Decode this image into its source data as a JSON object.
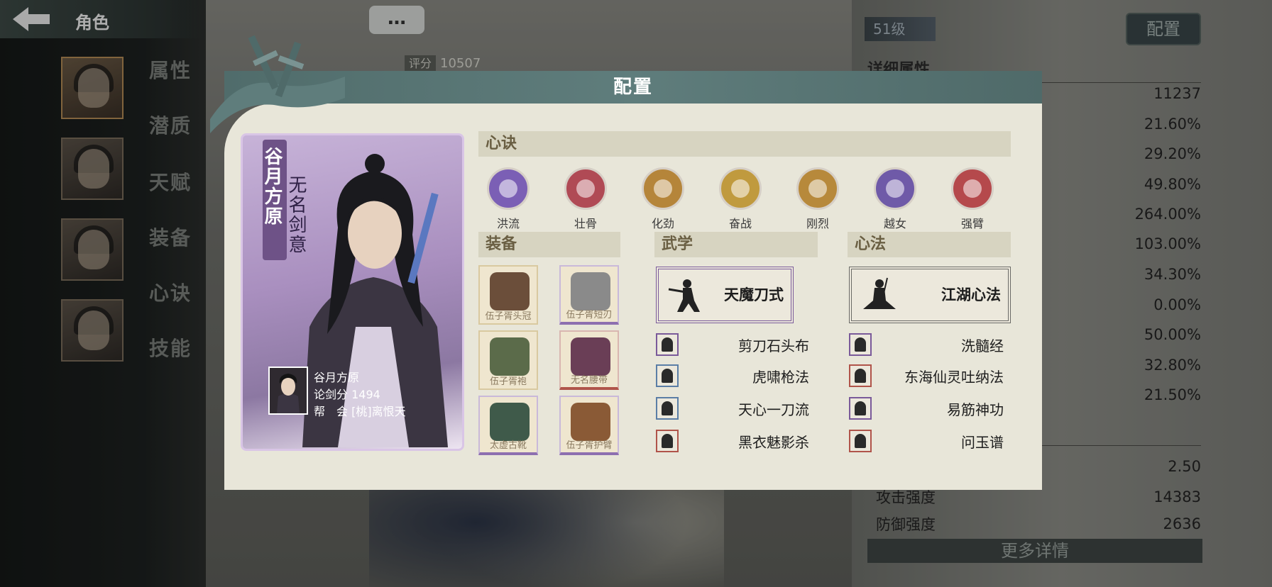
{
  "header": {
    "title": "角色",
    "chat_icon": "…"
  },
  "sidebar": {
    "tabs": [
      {
        "label": "属性"
      },
      {
        "label": "潜质"
      },
      {
        "label": "天赋"
      },
      {
        "label": "装备"
      },
      {
        "label": "心诀"
      },
      {
        "label": "技能"
      }
    ]
  },
  "score": {
    "label": "评分",
    "value": "10507"
  },
  "right_panel": {
    "level": "51级",
    "config_button": "配置",
    "detail_title": "详细属性",
    "values": [
      "11237",
      "21.60%",
      "29.20%",
      "49.80%",
      "264.00%",
      "103.00%",
      "34.30%",
      "0.00%",
      "50.00%",
      "32.80%",
      "21.50%"
    ],
    "bottom_values": [
      "2.50"
    ],
    "labeled_stats": [
      {
        "label": "攻击强度",
        "value": "14383"
      },
      {
        "label": "防御强度",
        "value": "2636"
      }
    ],
    "more_button": "更多详情"
  },
  "dialog": {
    "title": "配置",
    "character": {
      "name": "谷月方原",
      "title": "无名剑意",
      "info_name": "谷月方原",
      "duel_score_label": "论剑分",
      "duel_score": "1494",
      "guild_label": "帮　会",
      "guild": "[桃]离恨天"
    },
    "xinjue": {
      "heading": "心诀",
      "items": [
        {
          "label": "洪流",
          "color": "#7b5fb5"
        },
        {
          "label": "壮骨",
          "color": "#b04a55"
        },
        {
          "label": "化劲",
          "color": "#b5853a"
        },
        {
          "label": "奋战",
          "color": "#c09a3e"
        },
        {
          "label": "刚烈",
          "color": "#b7893b"
        },
        {
          "label": "越女",
          "color": "#6f5aa8"
        },
        {
          "label": "强臂",
          "color": "#b5494c"
        }
      ]
    },
    "equipment": {
      "heading": "装备",
      "items": [
        {
          "name": "伍子胥头冠",
          "art_color": "#6b4e3a"
        },
        {
          "name": "伍子胥短刃",
          "art_color": "#8a8a8a"
        },
        {
          "name": "伍子胥袍",
          "art_color": "#5b6b4a"
        },
        {
          "name": "无名腰带",
          "art_color": "#6a3e56"
        },
        {
          "name": "太虚古靴",
          "art_color": "#3f5a4a"
        },
        {
          "name": "伍子胥护臂",
          "art_color": "#8a5a36"
        }
      ]
    },
    "wuxue": {
      "heading": "武学",
      "main": "天魔刀式",
      "list": [
        "剪刀石头布",
        "虎啸枪法",
        "天心一刀流",
        "黑衣魅影杀"
      ]
    },
    "xinfa": {
      "heading": "心法",
      "main": "江湖心法",
      "list": [
        "洗髓经",
        "东海仙灵吐纳法",
        "易筋神功",
        "问玉谱"
      ]
    }
  }
}
